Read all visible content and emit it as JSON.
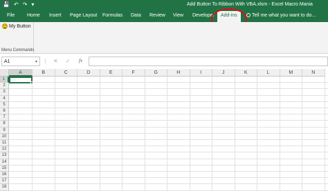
{
  "titlebar": {
    "title": "Add Button To Ribbon With VBA.xlsm - Excel Macro Mania",
    "save_icon": "💾",
    "undo_icon": "↶",
    "redo_icon": "↷",
    "customize_icon": "▾"
  },
  "ribbon": {
    "tabs": [
      "File",
      "Home",
      "Insert",
      "Page Layout",
      "Formulas",
      "Data",
      "Review",
      "View",
      "Developer",
      "Add-ins"
    ],
    "active_tab": "Add-ins",
    "tell_me": "Tell me what you want to do...",
    "group": {
      "button_label": "My Button",
      "label": "Menu Commands"
    }
  },
  "formula_bar": {
    "name_box": "A1",
    "name_box_arrow": "▾",
    "dots": "⋮",
    "cancel": "✕",
    "enter": "✓",
    "fx": "fx",
    "value": ""
  },
  "grid": {
    "columns": [
      "A",
      "B",
      "C",
      "D",
      "E",
      "F",
      "G",
      "H",
      "I",
      "J",
      "K",
      "L",
      "M",
      "N"
    ],
    "rows": [
      "1",
      "2",
      "3",
      "4",
      "5",
      "6",
      "7",
      "8",
      "9",
      "10",
      "11",
      "12",
      "13",
      "14",
      "15",
      "16",
      "17",
      "18"
    ],
    "selected_cell": "A1"
  },
  "colors": {
    "excel_green": "#217346",
    "annotation_red": "#dd1111"
  }
}
